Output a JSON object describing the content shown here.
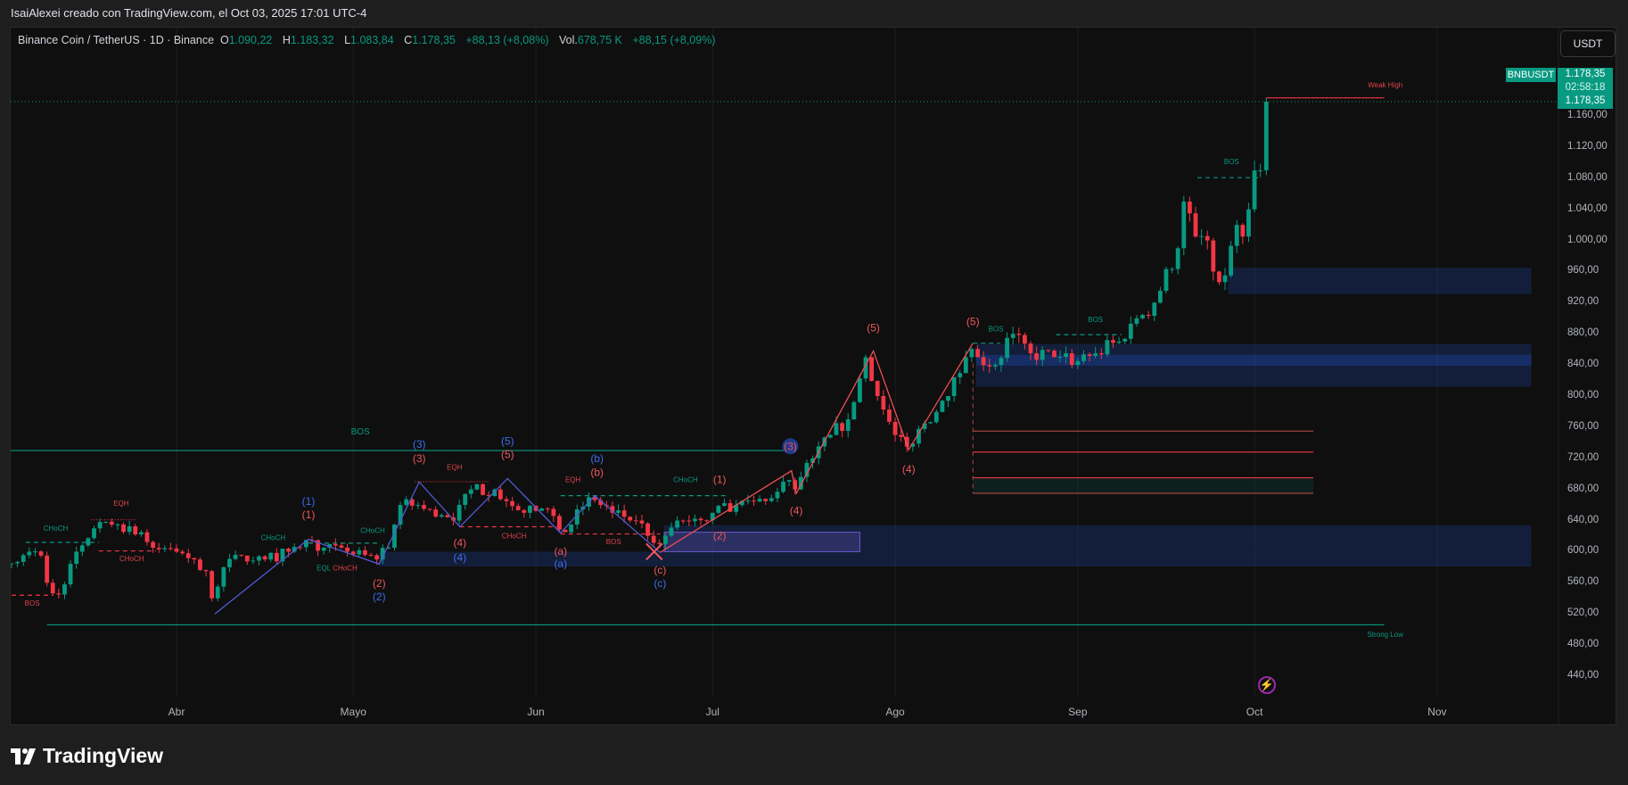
{
  "header": {
    "credit": "IsaiAlexei creado con TradingView.com, el Oct 03, 2025 17:01 UTC-4"
  },
  "legend": {
    "symbol": "Binance Coin / TetherUS · 1D · Binance",
    "open_label": "O",
    "open": "1.090,22",
    "high_label": "H",
    "high": "1.183,32",
    "low_label": "L",
    "low": "1.083,84",
    "close_label": "C",
    "close": "1.178,35",
    "change": "+88,13 (+8,08%)",
    "vol_label": "Vol.",
    "vol": "678,75 K",
    "vol_change": "+88,15 (+8,09%)"
  },
  "currency_button": "USDT",
  "price_tag": {
    "symbol": "BNBUSDT",
    "price": "1.178,35",
    "countdown": "02:58:18",
    "last": "1.178,35"
  },
  "price_axis": [
    "1.160,00",
    "1.120,00",
    "1.080,00",
    "1.040,00",
    "1.000,00",
    "960,00",
    "920,00",
    "880,00",
    "840,00",
    "800,00",
    "760,00",
    "720,00",
    "680,00",
    "640,00",
    "600,00",
    "560,00",
    "520,00",
    "480,00",
    "440,00"
  ],
  "time_axis": [
    {
      "label": "Abr",
      "day": 0
    },
    {
      "label": "Mayo",
      "day": 30
    },
    {
      "label": "Jun",
      "day": 61
    },
    {
      "label": "Jul",
      "day": 91
    },
    {
      "label": "Ago",
      "day": 122
    },
    {
      "label": "Sep",
      "day": 153
    },
    {
      "label": "Oct",
      "day": 183
    },
    {
      "label": "Nov",
      "day": 214
    }
  ],
  "footer": {
    "brand": "TradingView"
  },
  "colors": {
    "up": "#089981",
    "down": "#f23645",
    "blue": "#2962ff",
    "teal": "#089981",
    "red": "#f23645",
    "zone": "#1b2a4a"
  },
  "chart_data": {
    "type": "candlestick",
    "symbol": "BNBUSDT",
    "interval": "1D",
    "x_unit": "days since Apr 1 2025",
    "ylim": [
      420,
      1200
    ],
    "key_closes": [
      [
        -28,
        585
      ],
      [
        -25,
        600
      ],
      [
        -23,
        595
      ],
      [
        -22,
        560
      ],
      [
        -20,
        545
      ],
      [
        -17,
        600
      ],
      [
        -14,
        630
      ],
      [
        -10,
        635
      ],
      [
        -6,
        625
      ],
      [
        -4,
        605
      ],
      [
        0,
        600
      ],
      [
        3,
        590
      ],
      [
        5,
        575
      ],
      [
        6,
        540
      ],
      [
        8,
        580
      ],
      [
        11,
        595
      ],
      [
        15,
        590
      ],
      [
        19,
        600
      ],
      [
        22,
        615
      ],
      [
        25,
        605
      ],
      [
        29,
        600
      ],
      [
        34,
        590
      ],
      [
        36,
        605
      ],
      [
        38,
        660
      ],
      [
        41,
        660
      ],
      [
        44,
        645
      ],
      [
        47,
        640
      ],
      [
        50,
        680
      ],
      [
        54,
        680
      ],
      [
        56,
        665
      ],
      [
        59,
        650
      ],
      [
        63,
        655
      ],
      [
        66,
        625
      ],
      [
        70,
        670
      ],
      [
        74,
        650
      ],
      [
        78,
        640
      ],
      [
        82,
        610
      ],
      [
        85,
        640
      ],
      [
        91,
        650
      ],
      [
        95,
        660
      ],
      [
        100,
        665
      ],
      [
        103,
        690
      ],
      [
        105,
        680
      ],
      [
        108,
        720
      ],
      [
        111,
        750
      ],
      [
        114,
        770
      ],
      [
        117,
        850
      ],
      [
        119,
        800
      ],
      [
        122,
        750
      ],
      [
        124,
        735
      ],
      [
        127,
        765
      ],
      [
        131,
        800
      ],
      [
        134,
        850
      ],
      [
        136,
        850
      ],
      [
        139,
        840
      ],
      [
        142,
        880
      ],
      [
        145,
        855
      ],
      [
        149,
        850
      ],
      [
        153,
        845
      ],
      [
        156,
        855
      ],
      [
        160,
        870
      ],
      [
        163,
        900
      ],
      [
        166,
        920
      ],
      [
        170,
        990
      ],
      [
        171,
        1050
      ],
      [
        173,
        1005
      ],
      [
        175,
        1000
      ],
      [
        176,
        960
      ],
      [
        178,
        955
      ],
      [
        180,
        1020
      ],
      [
        181,
        1005
      ],
      [
        182,
        1040
      ],
      [
        183,
        1090
      ],
      [
        184,
        1090
      ]
    ],
    "last_candle": {
      "day": 185,
      "open": 1090.22,
      "high": 1183.32,
      "low": 1083.84,
      "close": 1178.35
    },
    "zones": [
      {
        "from": 82.8,
        "to": 230,
        "low": 600,
        "high": 634,
        "kind": "zone"
      },
      {
        "from": 34.4,
        "to": 230,
        "low": 581,
        "high": 600,
        "kind": "zone"
      },
      {
        "from": 82.8,
        "to": 116,
        "low": 600,
        "high": 625,
        "kind": "purple"
      },
      {
        "from": 135.7,
        "to": 230,
        "low": 812,
        "high": 867,
        "kind": "zone"
      },
      {
        "from": 135.7,
        "to": 230,
        "low": 839,
        "high": 853,
        "kind": "zone-strong"
      },
      {
        "from": 178.5,
        "to": 230,
        "low": 931,
        "high": 965,
        "kind": "zone"
      },
      {
        "from": 135.2,
        "to": 193,
        "low": 675,
        "high": 695,
        "kind": "green"
      }
    ],
    "lines": [
      {
        "from": -32,
        "to": 104.4,
        "price": 730,
        "color": "teal",
        "style": "solid"
      },
      {
        "from": -22,
        "to": 205,
        "price": 506,
        "color": "teal",
        "style": "solid"
      },
      {
        "from": 185,
        "to": 205,
        "price": 1183.3,
        "color": "red",
        "style": "solid"
      },
      {
        "from": 135.2,
        "to": 193,
        "price": 755,
        "color": "brown",
        "style": "solid"
      },
      {
        "from": 135.2,
        "to": 193,
        "price": 728,
        "color": "red",
        "style": "solid"
      },
      {
        "from": 135.2,
        "to": 193,
        "price": 695,
        "color": "red",
        "style": "solid"
      },
      {
        "from": 135.2,
        "to": 193,
        "price": 675,
        "color": "brown",
        "style": "solid"
      },
      {
        "from": 173.3,
        "to": 183.8,
        "price": 1080.7,
        "color": "teal",
        "style": "dashed"
      },
      {
        "from": 149.3,
        "to": 160.4,
        "price": 879,
        "color": "teal",
        "style": "dashed"
      },
      {
        "from": 135.2,
        "to": 139.8,
        "price": 868,
        "color": "teal",
        "style": "dashed"
      },
      {
        "from": 65.2,
        "to": 93.4,
        "price": 672,
        "color": "teal",
        "style": "dashed"
      },
      {
        "from": 65.2,
        "to": 82.1,
        "price": 622.8,
        "color": "red",
        "style": "dashed"
      },
      {
        "from": 48.1,
        "to": 65.2,
        "price": 632,
        "color": "red",
        "style": "dashed"
      },
      {
        "from": 40.5,
        "to": 52.9,
        "price": 690,
        "color": "red",
        "style": "dotted"
      },
      {
        "from": -28,
        "to": -21,
        "price": 544,
        "color": "red",
        "style": "dashed"
      },
      {
        "from": -25.6,
        "to": -13.2,
        "price": 612,
        "color": "teal",
        "style": "dashed"
      },
      {
        "from": -13.2,
        "to": -3.5,
        "price": 601,
        "color": "red",
        "style": "dashed"
      },
      {
        "from": -14.5,
        "to": -7,
        "price": 641,
        "color": "red",
        "style": "dotted"
      },
      {
        "from": 22.4,
        "to": 34.4,
        "price": 611,
        "color": "teal",
        "style": "dashed"
      }
    ],
    "wave_paths": [
      {
        "color": "blue",
        "points": [
          [
            6.5,
            520
          ],
          [
            22.4,
            616
          ],
          [
            34.4,
            584
          ],
          [
            41.2,
            689.5
          ],
          [
            48.1,
            632
          ],
          [
            56.2,
            694
          ],
          [
            65.2,
            624
          ],
          [
            71.0,
            672
          ],
          [
            82.1,
            599
          ]
        ]
      },
      {
        "color": "red",
        "points": [
          [
            82.1,
            599
          ],
          [
            104.4,
            704
          ],
          [
            105.2,
            675
          ],
          [
            118.3,
            858
          ],
          [
            124.3,
            731
          ],
          [
            135.2,
            868
          ]
        ]
      }
    ],
    "wave_labels": [
      {
        "text": "(1)",
        "day": 22.4,
        "price": 660.2,
        "color": "blue"
      },
      {
        "text": "(1)",
        "day": 22.4,
        "price": 642.8,
        "color": "red"
      },
      {
        "text": "(2)",
        "day": 34.4,
        "price": 554.7,
        "color": "red"
      },
      {
        "text": "(2)",
        "day": 34.4,
        "price": 537.3,
        "color": "blue"
      },
      {
        "text": "(3)",
        "day": 41.2,
        "price": 733.6,
        "color": "blue"
      },
      {
        "text": "(3)",
        "day": 41.2,
        "price": 714.9,
        "color": "red"
      },
      {
        "text": "(4)",
        "day": 48.1,
        "price": 606.7,
        "color": "red"
      },
      {
        "text": "(4)",
        "day": 48.1,
        "price": 588.0,
        "color": "blue"
      },
      {
        "text": "(5)",
        "day": 56.2,
        "price": 737.6,
        "color": "blue"
      },
      {
        "text": "(5)",
        "day": 56.2,
        "price": 720.2,
        "color": "red"
      },
      {
        "text": "(a)",
        "day": 65.2,
        "price": 596.0,
        "color": "red"
      },
      {
        "text": "(a)",
        "day": 65.2,
        "price": 580.0,
        "color": "blue"
      },
      {
        "text": "(b)",
        "day": 71.4,
        "price": 714.9,
        "color": "blue"
      },
      {
        "text": "(b)",
        "day": 71.4,
        "price": 697.5,
        "color": "red"
      },
      {
        "text": "(c)",
        "day": 82.1,
        "price": 572.0,
        "color": "red"
      },
      {
        "text": "(c)",
        "day": 82.1,
        "price": 554.7,
        "color": "blue"
      },
      {
        "text": "(1)",
        "day": 92.2,
        "price": 688.2,
        "color": "red"
      },
      {
        "text": "(2)",
        "day": 92.2,
        "price": 616.0,
        "color": "red"
      },
      {
        "text": "(3)",
        "day": 104.2,
        "price": 730.9,
        "color": "red",
        "circled": true
      },
      {
        "text": "(4)",
        "day": 105.2,
        "price": 648.1,
        "color": "red"
      },
      {
        "text": "(5)",
        "day": 118.3,
        "price": 883.1,
        "color": "red"
      },
      {
        "text": "(4)",
        "day": 124.3,
        "price": 701.5,
        "color": "red"
      },
      {
        "text": "(5)",
        "day": 135.2,
        "price": 891.1,
        "color": "red"
      }
    ],
    "structure_labels": [
      {
        "text": "EQH",
        "day": -9.4,
        "price": 658.8,
        "color": "red"
      },
      {
        "text": "EQH",
        "day": 47.2,
        "price": 705.6,
        "color": "red"
      },
      {
        "text": "EQH",
        "day": 67.3,
        "price": 689.5,
        "color": "red"
      },
      {
        "text": "CHoCH",
        "day": -20.5,
        "price": 626.8,
        "color": "teal"
      },
      {
        "text": "CHoCH",
        "day": 16.4,
        "price": 614.8,
        "color": "teal"
      },
      {
        "text": "CHoCH",
        "day": 33.3,
        "price": 624.1,
        "color": "teal"
      },
      {
        "text": "CHoCH",
        "day": 86.4,
        "price": 689.5,
        "color": "teal"
      },
      {
        "text": "CHoCH",
        "day": -7.6,
        "price": 588.1,
        "color": "red"
      },
      {
        "text": "CHoCH",
        "day": 57.3,
        "price": 617.4,
        "color": "red"
      },
      {
        "text": "CHoCH",
        "day": 28.6,
        "price": 576.0,
        "color": "red"
      },
      {
        "text": "EQL",
        "day": 25.0,
        "price": 576.0,
        "color": "teal"
      },
      {
        "text": "BOS",
        "day": -24.5,
        "price": 530.6,
        "color": "red"
      },
      {
        "text": "BOS",
        "day": 74.2,
        "price": 609.4,
        "color": "red"
      },
      {
        "text": "BOS",
        "day": 139.1,
        "price": 883.1,
        "color": "teal"
      },
      {
        "text": "BOS",
        "day": 156.0,
        "price": 895.1,
        "color": "teal"
      },
      {
        "text": "BOS",
        "day": 179.1,
        "price": 1098,
        "color": "teal"
      },
      {
        "text": "BOS",
        "day": 31.2,
        "price": 750.9,
        "color": "teal",
        "large": true
      },
      {
        "text": "Strong Low",
        "day": 205.2,
        "price": 490.6,
        "color": "teal"
      },
      {
        "text": "Weak High",
        "day": 205.2,
        "price": 1196.9,
        "color": "red"
      }
    ],
    "x_marks": [
      {
        "day": 81.1,
        "price": 600,
        "color": "red"
      }
    ]
  }
}
